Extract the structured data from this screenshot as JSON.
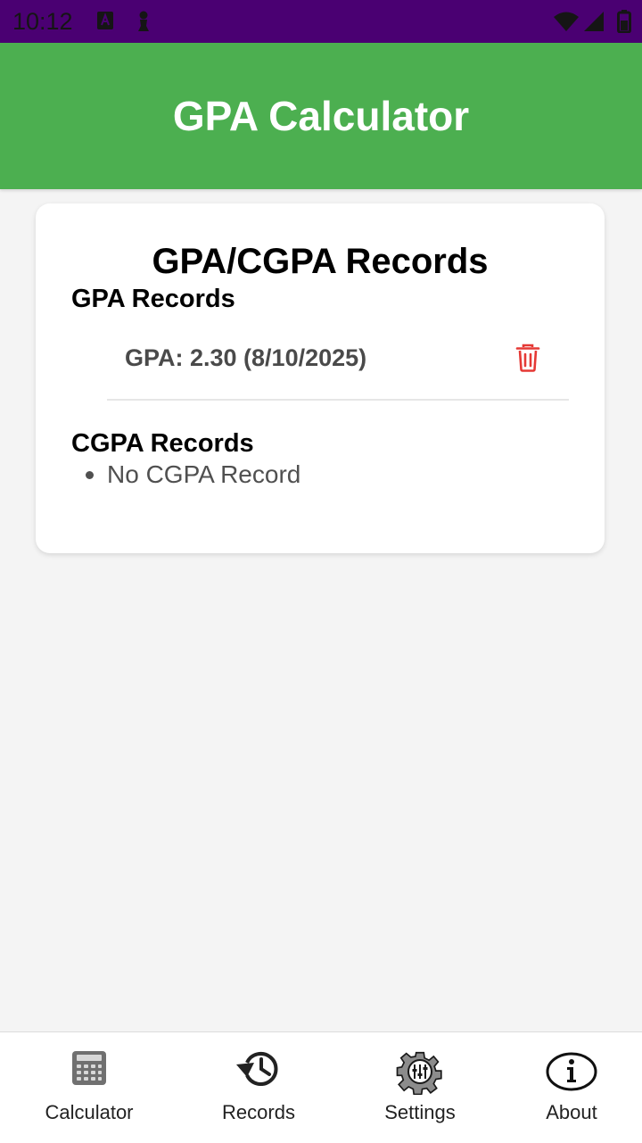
{
  "status_bar": {
    "time": "10:12",
    "background": "#4a0072"
  },
  "app_bar": {
    "title": "GPA Calculator",
    "color": "#4caf50"
  },
  "records_card": {
    "title": "GPA/CGPA Records",
    "gpa_section": {
      "title": "GPA Records",
      "items": [
        {
          "text": "GPA: 2.30 (8/10/2025)",
          "action_icon": "trash-icon"
        }
      ]
    },
    "cgpa_section": {
      "title": "CGPA Records",
      "items": [
        {
          "text": "No CGPA Record"
        }
      ]
    }
  },
  "bottom_nav": {
    "items": [
      {
        "label": "Calculator",
        "icon": "calculator-icon"
      },
      {
        "label": "Records",
        "icon": "history-icon"
      },
      {
        "label": "Settings",
        "icon": "settings-gear-icon"
      },
      {
        "label": "About",
        "icon": "info-icon"
      }
    ]
  },
  "colors": {
    "delete": "#e53935",
    "page_background": "#f4f4f4"
  }
}
